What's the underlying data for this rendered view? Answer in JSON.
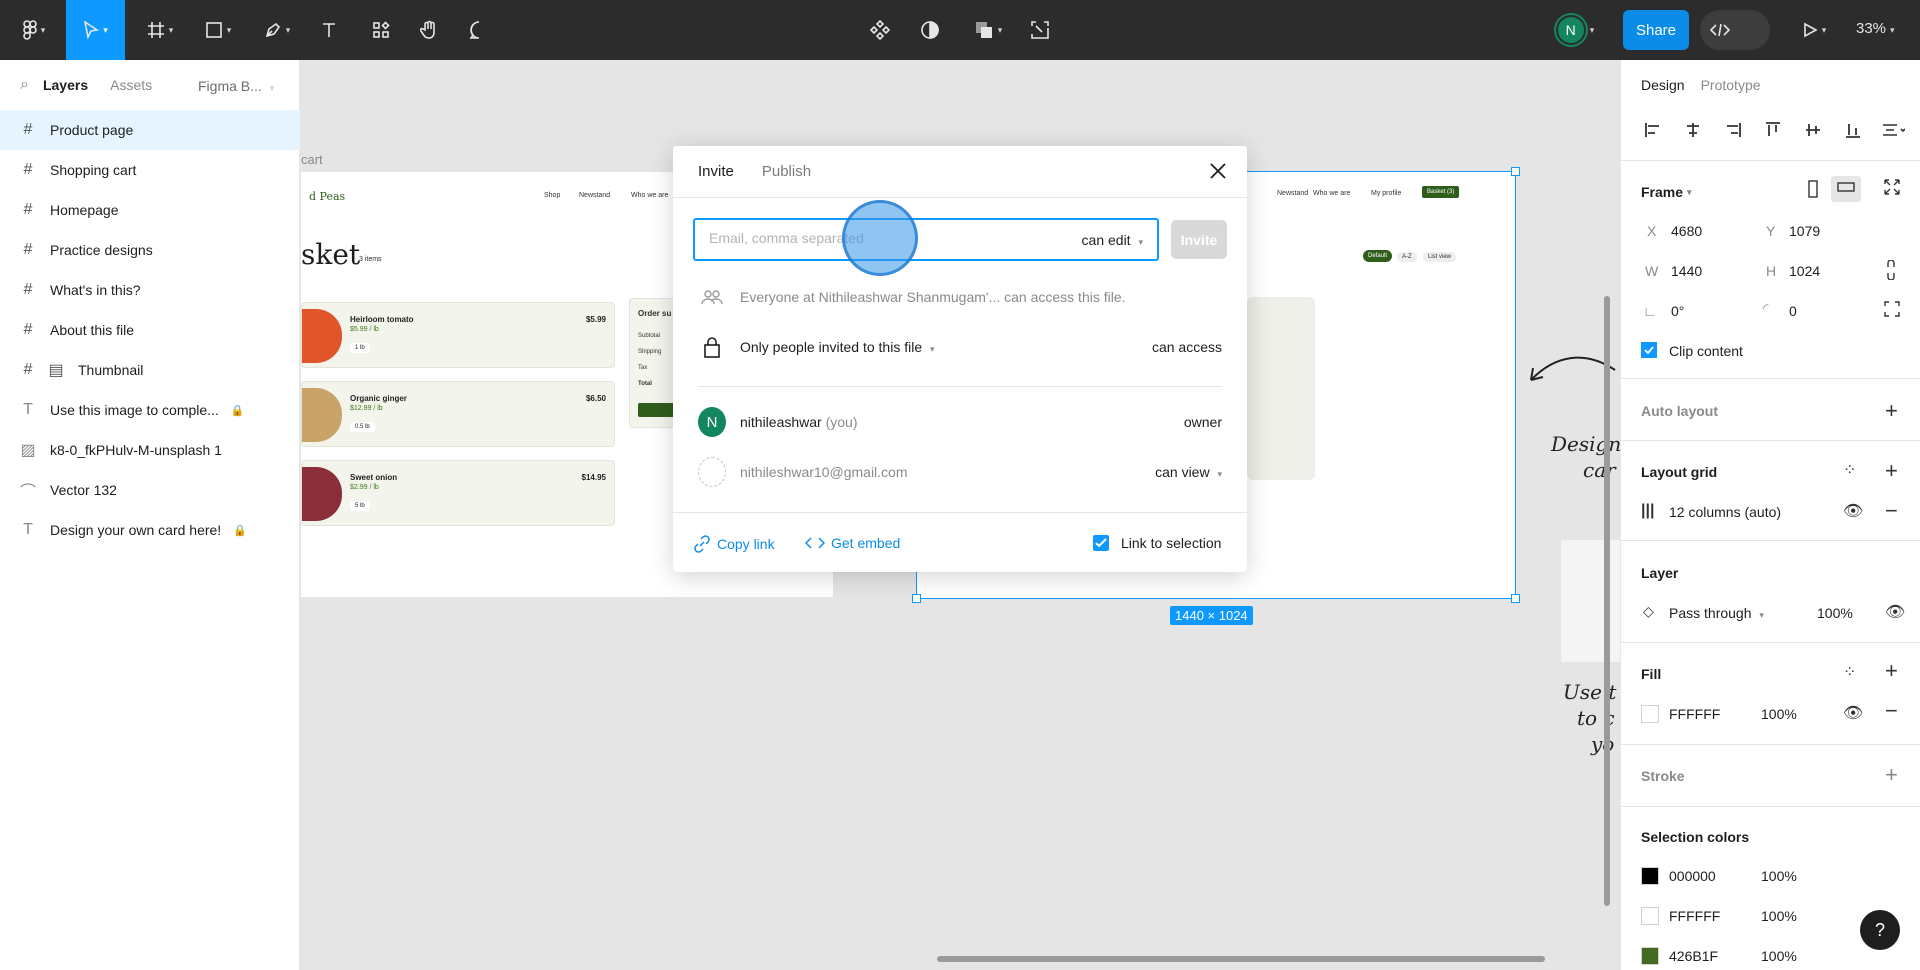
{
  "toolbar": {
    "zoom": "33%",
    "share_label": "Share",
    "user_initial": "N"
  },
  "layers_panel": {
    "tabs": [
      "Layers",
      "Assets"
    ],
    "page_name": "Figma B...",
    "items": [
      {
        "label": "Product page",
        "icon": "frame-icon",
        "selected": true
      },
      {
        "label": "Shopping cart",
        "icon": "frame-icon"
      },
      {
        "label": "Homepage",
        "icon": "frame-icon"
      },
      {
        "label": "Practice designs",
        "icon": "frame-icon"
      },
      {
        "label": "What's in this?",
        "icon": "frame-icon"
      },
      {
        "label": "About this file",
        "icon": "frame-icon"
      },
      {
        "label": "Thumbnail",
        "icon": "frame-icon"
      },
      {
        "label": "Use this image to comple...",
        "icon": "text-icon",
        "locked": true
      },
      {
        "label": "k8-0_fkPHulv-M-unsplash 1",
        "icon": "image-icon"
      },
      {
        "label": "Vector 132",
        "icon": "vector-icon"
      },
      {
        "label": "Design your own card here!",
        "icon": "text-icon",
        "locked": true
      }
    ]
  },
  "canvas": {
    "frame_label": "cart",
    "dims_badge": "1440 × 1024",
    "left_frame": {
      "logo": "d Peas",
      "nav": [
        "Shop",
        "Newstand",
        "Who we are"
      ],
      "heading": "sket",
      "count": "3 items",
      "order_title": "Order su",
      "order_lines": [
        "Subtotal",
        "Shipping",
        "Tax",
        "Total"
      ],
      "cards": [
        {
          "name": "Heirloom tomato",
          "price": "$5.99 / lb",
          "qty": "1 lb",
          "total": "$5.99"
        },
        {
          "name": "Organic ginger",
          "price": "$12.99 / lb",
          "qty": "0.5 lb",
          "total": "$6.50"
        },
        {
          "name": "Sweet onion",
          "price": "$2.99 / lb",
          "qty": "5 lb",
          "total": "$14.95"
        }
      ]
    },
    "right_frame": {
      "nav": [
        "Newstand",
        "Who we are",
        "My profile"
      ],
      "basket_btn": "Basket (3)",
      "sort_btns": [
        "Default",
        "A-Z",
        "List view"
      ]
    },
    "handwriting": [
      "Design",
      "car",
      "Use t",
      "to c",
      "yo"
    ]
  },
  "share_modal": {
    "tabs": [
      "Invite",
      "Publish"
    ],
    "email_placeholder": "Email, comma separated",
    "permission": "can edit",
    "invite_label": "Invite",
    "org_access_text": "Everyone at Nithileashwar Shanmugam'... can access this file.",
    "access_mode": "Only people invited to this file",
    "access_right": "can access",
    "users": [
      {
        "initial": "N",
        "name": "nithileashwar",
        "suffix": "(you)",
        "role": "owner"
      },
      {
        "initial": "",
        "name": "nithileshwar10@gmail.com",
        "suffix": "",
        "role": "can view"
      }
    ],
    "copy_link": "Copy link",
    "get_embed": "Get embed",
    "link_to_selection": "Link to selection"
  },
  "design_panel": {
    "tabs": [
      "Design",
      "Prototype"
    ],
    "frame_title": "Frame",
    "x": "4680",
    "y": "1079",
    "w": "1440",
    "h": "1024",
    "rotation": "0°",
    "radius": "0",
    "clip_content": "Clip content",
    "auto_layout": "Auto layout",
    "layout_grid": "Layout grid",
    "grid_value": "12 columns (auto)",
    "layer": "Layer",
    "blend": "Pass through",
    "layer_opacity": "100%",
    "fill": "Fill",
    "fill_hex": "FFFFFF",
    "fill_opacity": "100%",
    "stroke": "Stroke",
    "selection_colors": "Selection colors",
    "colors": [
      {
        "hex": "000000",
        "opacity": "100%",
        "swatch": "#000000"
      },
      {
        "hex": "FFFFFF",
        "opacity": "100%",
        "swatch": "#FFFFFF"
      },
      {
        "hex": "426B1F",
        "opacity": "100%",
        "swatch": "#426B1F"
      }
    ]
  },
  "help": "?"
}
